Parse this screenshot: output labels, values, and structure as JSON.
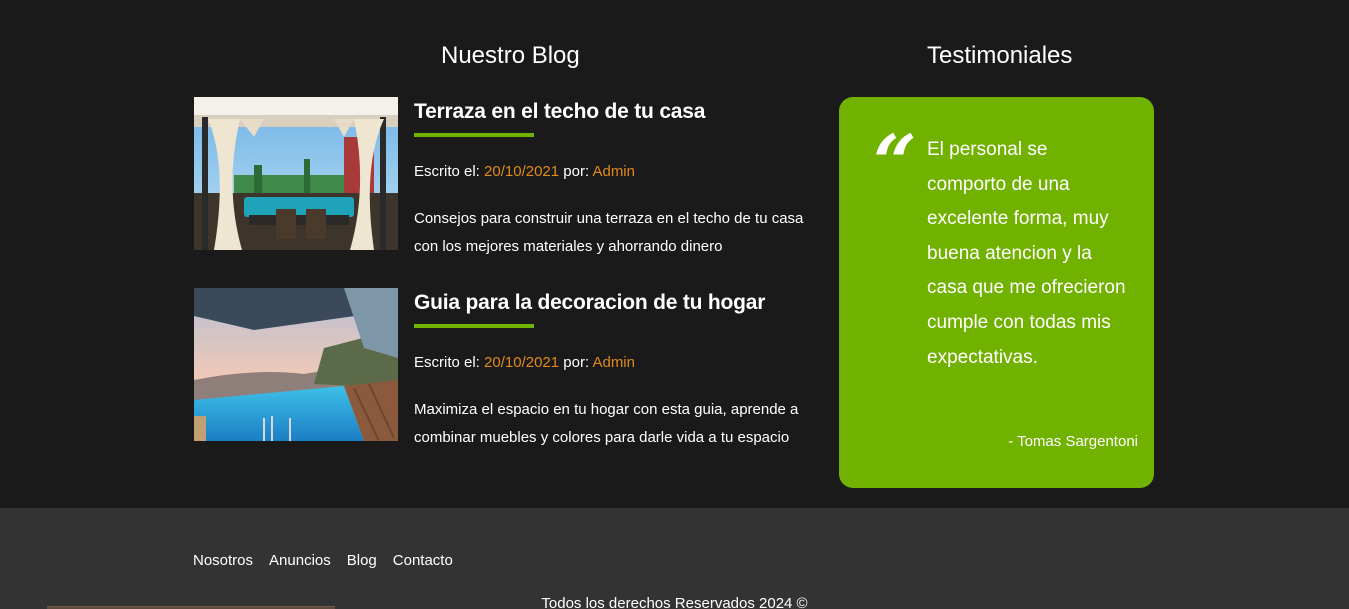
{
  "blog": {
    "title": "Nuestro Blog",
    "entries": [
      {
        "heading": "Terraza en el techo de tu casa",
        "meta_written": "Escrito el: ",
        "date": "20/10/2021",
        "meta_by": " por: ",
        "author": "Admin",
        "excerpt": "Consejos para construir una terraza en el techo de tu casa con los mejores materiales y ahorrando dinero",
        "image_icon": "rooftop-terrace-image"
      },
      {
        "heading": "Guia para la decoracion de tu hogar",
        "meta_written": "Escrito el: ",
        "date": "20/10/2021",
        "meta_by": " por: ",
        "author": "Admin",
        "excerpt": "Maximiza el espacio en tu hogar con esta guia, aprende a combinar muebles y colores para darle vida a tu espacio",
        "image_icon": "infinity-pool-image"
      }
    ]
  },
  "testimonials": {
    "title": "Testimoniales",
    "quote_mark": "“",
    "text": "El personal se comporto de una excelente forma, muy buena atencion y la casa que me ofrecieron cumple con todas mis expectativas.",
    "author": "- Tomas Sargentoni"
  },
  "footer": {
    "nav": [
      "Nosotros",
      "Anuncios",
      "Blog",
      "Contacto"
    ],
    "copyright": "Todos los derechos Reservados 2024 ©"
  },
  "colors": {
    "accent_green": "#71b100",
    "accent_orange": "#e08a1e",
    "background": "#1a1a1a",
    "footer_background": "#333333"
  }
}
